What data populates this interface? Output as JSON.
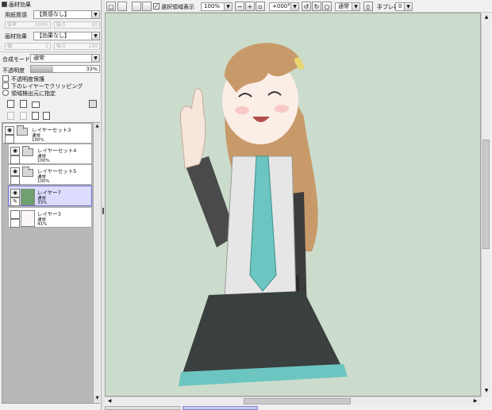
{
  "texture_panel": {
    "header": "画材効果",
    "paper_label": "用紙質感",
    "paper_value": "【質感なし】",
    "paper_scale": "100%",
    "paper_strength": "20",
    "paper_scale_label": "倍率",
    "paper_strength_label": "強さ",
    "effect_label": "画材効果",
    "effect_value": "【効果なし】",
    "effect_width": "1",
    "effect_strength": "100",
    "effect_width_label": "幅",
    "effect_strength_label": "強さ"
  },
  "blend": {
    "label": "合成モード",
    "value": "通常",
    "opacity_label": "不透明度",
    "opacity_value": "33%",
    "opacity_level": 0.33
  },
  "options": [
    {
      "label": "不透明度保護"
    },
    {
      "label": "下のレイヤーでクリッピング"
    },
    {
      "label": "領域検出元に指定"
    }
  ],
  "layers": [
    {
      "name": "レイヤーセット3",
      "mode": "通常",
      "opacity": "100%",
      "type": "folder",
      "visible": true
    },
    {
      "name": "レイヤーセット4",
      "mode": "通常",
      "opacity": "100%",
      "type": "folder",
      "visible": true
    },
    {
      "name": "レイヤーセット5",
      "mode": "通常",
      "opacity": "100%",
      "type": "folder",
      "visible": true
    },
    {
      "name": "レイヤー7",
      "mode": "通常",
      "opacity": "33%",
      "type": "green",
      "visible": true,
      "selected": true
    },
    {
      "name": "レイヤー3",
      "mode": "通常",
      "opacity": "41%",
      "type": "sketch",
      "visible": false
    }
  ],
  "toolbar": {
    "show_selection_label": "選択領域表示",
    "zoom": "100%",
    "rotation": "+000°",
    "blend_mode": "通常",
    "stabilizer_label": "手ブレ補正",
    "stabilizer_value": "0"
  },
  "colors": {
    "canvas_bg": "#ccdccc",
    "selected_layer": "#dcdcff",
    "layer7_thumb": "#6fa06f"
  }
}
